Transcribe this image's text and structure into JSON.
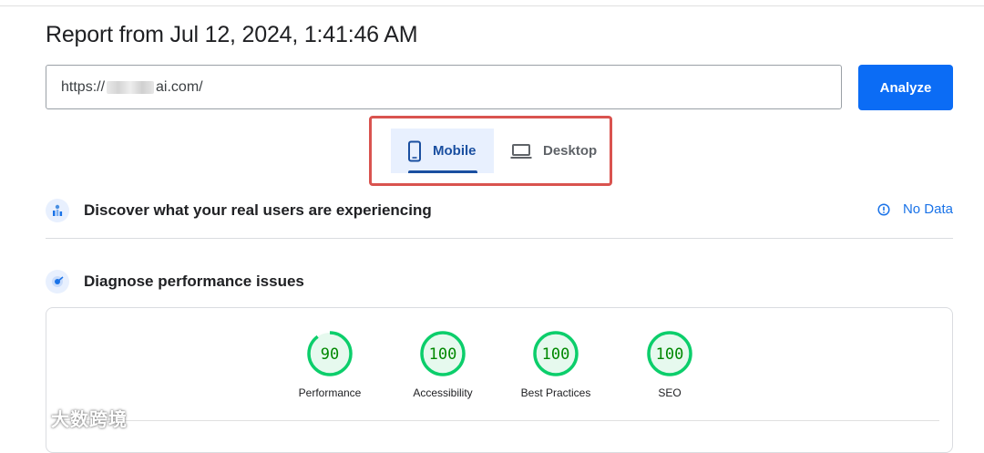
{
  "report": {
    "title": "Report from Jul 12, 2024, 1:41:46 AM"
  },
  "url_bar": {
    "prefix": "https://",
    "suffix": "ai.com/"
  },
  "analyze_label": "Analyze",
  "tabs": [
    {
      "label": "Mobile",
      "icon": "smartphone-icon",
      "selected": true
    },
    {
      "label": "Desktop",
      "icon": "laptop-icon",
      "selected": false
    }
  ],
  "field_data": {
    "title": "Discover what your real users are experiencing",
    "status": "No Data",
    "icon": "users-chart-icon"
  },
  "lab_data": {
    "title": "Diagnose performance issues",
    "icon": "lighthouse-icon"
  },
  "scores": [
    {
      "label": "Performance",
      "value": "90"
    },
    {
      "label": "Accessibility",
      "value": "100"
    },
    {
      "label": "Best Practices",
      "value": "100"
    },
    {
      "label": "SEO",
      "value": "100"
    }
  ],
  "watermark": "大数跨境",
  "colors": {
    "accent": "#0b6cf5",
    "pass": "#0cce6b",
    "pass_text": "#008800",
    "tab_selected": "#1a4fa0",
    "highlight": "#d9534f"
  }
}
